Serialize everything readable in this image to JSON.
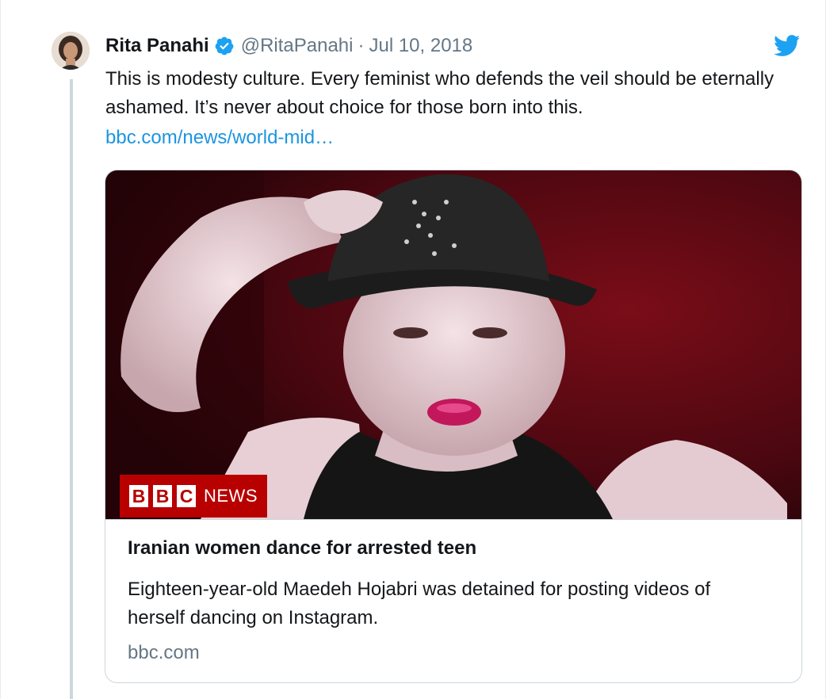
{
  "tweet": {
    "author_name": "Rita Panahi",
    "handle": "@RitaPanahi",
    "separator": "·",
    "date": "Jul 10, 2018",
    "text": "This is modesty culture. Every feminist who defends the veil should be eternally ashamed. It’s never about choice for those born into this.",
    "link_text": "bbc.com/news/world-mid…",
    "verified_icon": "verified-badge-icon",
    "platform_icon": "twitter-bird-icon"
  },
  "card": {
    "badge": {
      "letters": [
        "B",
        "B",
        "C"
      ],
      "label": "NEWS"
    },
    "title": "Iranian women dance for arrested teen",
    "description": "Eighteen-year-old Maedeh Hojabri was detained for posting videos of herself dancing on Instagram.",
    "domain": "bbc.com"
  },
  "colors": {
    "link": "#1b95e0",
    "verified": "#1da1f2",
    "secondary_text": "#657786",
    "bbc_red": "#b80000",
    "border": "#ccd6dd"
  }
}
